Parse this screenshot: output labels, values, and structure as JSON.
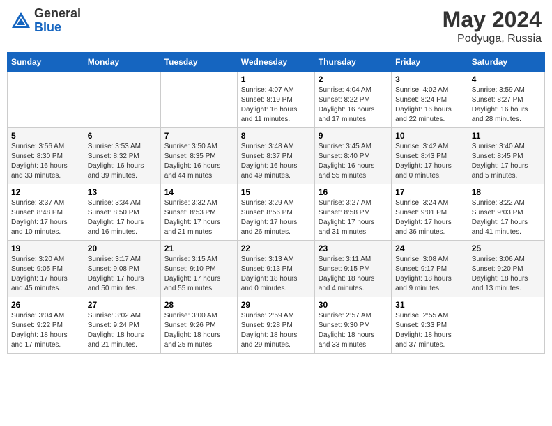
{
  "header": {
    "logo_general": "General",
    "logo_blue": "Blue",
    "month": "May 2024",
    "location": "Podyuga, Russia"
  },
  "days_of_week": [
    "Sunday",
    "Monday",
    "Tuesday",
    "Wednesday",
    "Thursday",
    "Friday",
    "Saturday"
  ],
  "weeks": [
    [
      {
        "day": "",
        "info": ""
      },
      {
        "day": "",
        "info": ""
      },
      {
        "day": "",
        "info": ""
      },
      {
        "day": "1",
        "info": "Sunrise: 4:07 AM\nSunset: 8:19 PM\nDaylight: 16 hours and 11 minutes."
      },
      {
        "day": "2",
        "info": "Sunrise: 4:04 AM\nSunset: 8:22 PM\nDaylight: 16 hours and 17 minutes."
      },
      {
        "day": "3",
        "info": "Sunrise: 4:02 AM\nSunset: 8:24 PM\nDaylight: 16 hours and 22 minutes."
      },
      {
        "day": "4",
        "info": "Sunrise: 3:59 AM\nSunset: 8:27 PM\nDaylight: 16 hours and 28 minutes."
      }
    ],
    [
      {
        "day": "5",
        "info": "Sunrise: 3:56 AM\nSunset: 8:30 PM\nDaylight: 16 hours and 33 minutes."
      },
      {
        "day": "6",
        "info": "Sunrise: 3:53 AM\nSunset: 8:32 PM\nDaylight: 16 hours and 39 minutes."
      },
      {
        "day": "7",
        "info": "Sunrise: 3:50 AM\nSunset: 8:35 PM\nDaylight: 16 hours and 44 minutes."
      },
      {
        "day": "8",
        "info": "Sunrise: 3:48 AM\nSunset: 8:37 PM\nDaylight: 16 hours and 49 minutes."
      },
      {
        "day": "9",
        "info": "Sunrise: 3:45 AM\nSunset: 8:40 PM\nDaylight: 16 hours and 55 minutes."
      },
      {
        "day": "10",
        "info": "Sunrise: 3:42 AM\nSunset: 8:43 PM\nDaylight: 17 hours and 0 minutes."
      },
      {
        "day": "11",
        "info": "Sunrise: 3:40 AM\nSunset: 8:45 PM\nDaylight: 17 hours and 5 minutes."
      }
    ],
    [
      {
        "day": "12",
        "info": "Sunrise: 3:37 AM\nSunset: 8:48 PM\nDaylight: 17 hours and 10 minutes."
      },
      {
        "day": "13",
        "info": "Sunrise: 3:34 AM\nSunset: 8:50 PM\nDaylight: 17 hours and 16 minutes."
      },
      {
        "day": "14",
        "info": "Sunrise: 3:32 AM\nSunset: 8:53 PM\nDaylight: 17 hours and 21 minutes."
      },
      {
        "day": "15",
        "info": "Sunrise: 3:29 AM\nSunset: 8:56 PM\nDaylight: 17 hours and 26 minutes."
      },
      {
        "day": "16",
        "info": "Sunrise: 3:27 AM\nSunset: 8:58 PM\nDaylight: 17 hours and 31 minutes."
      },
      {
        "day": "17",
        "info": "Sunrise: 3:24 AM\nSunset: 9:01 PM\nDaylight: 17 hours and 36 minutes."
      },
      {
        "day": "18",
        "info": "Sunrise: 3:22 AM\nSunset: 9:03 PM\nDaylight: 17 hours and 41 minutes."
      }
    ],
    [
      {
        "day": "19",
        "info": "Sunrise: 3:20 AM\nSunset: 9:05 PM\nDaylight: 17 hours and 45 minutes."
      },
      {
        "day": "20",
        "info": "Sunrise: 3:17 AM\nSunset: 9:08 PM\nDaylight: 17 hours and 50 minutes."
      },
      {
        "day": "21",
        "info": "Sunrise: 3:15 AM\nSunset: 9:10 PM\nDaylight: 17 hours and 55 minutes."
      },
      {
        "day": "22",
        "info": "Sunrise: 3:13 AM\nSunset: 9:13 PM\nDaylight: 18 hours and 0 minutes."
      },
      {
        "day": "23",
        "info": "Sunrise: 3:11 AM\nSunset: 9:15 PM\nDaylight: 18 hours and 4 minutes."
      },
      {
        "day": "24",
        "info": "Sunrise: 3:08 AM\nSunset: 9:17 PM\nDaylight: 18 hours and 9 minutes."
      },
      {
        "day": "25",
        "info": "Sunrise: 3:06 AM\nSunset: 9:20 PM\nDaylight: 18 hours and 13 minutes."
      }
    ],
    [
      {
        "day": "26",
        "info": "Sunrise: 3:04 AM\nSunset: 9:22 PM\nDaylight: 18 hours and 17 minutes."
      },
      {
        "day": "27",
        "info": "Sunrise: 3:02 AM\nSunset: 9:24 PM\nDaylight: 18 hours and 21 minutes."
      },
      {
        "day": "28",
        "info": "Sunrise: 3:00 AM\nSunset: 9:26 PM\nDaylight: 18 hours and 25 minutes."
      },
      {
        "day": "29",
        "info": "Sunrise: 2:59 AM\nSunset: 9:28 PM\nDaylight: 18 hours and 29 minutes."
      },
      {
        "day": "30",
        "info": "Sunrise: 2:57 AM\nSunset: 9:30 PM\nDaylight: 18 hours and 33 minutes."
      },
      {
        "day": "31",
        "info": "Sunrise: 2:55 AM\nSunset: 9:33 PM\nDaylight: 18 hours and 37 minutes."
      },
      {
        "day": "",
        "info": ""
      }
    ]
  ]
}
